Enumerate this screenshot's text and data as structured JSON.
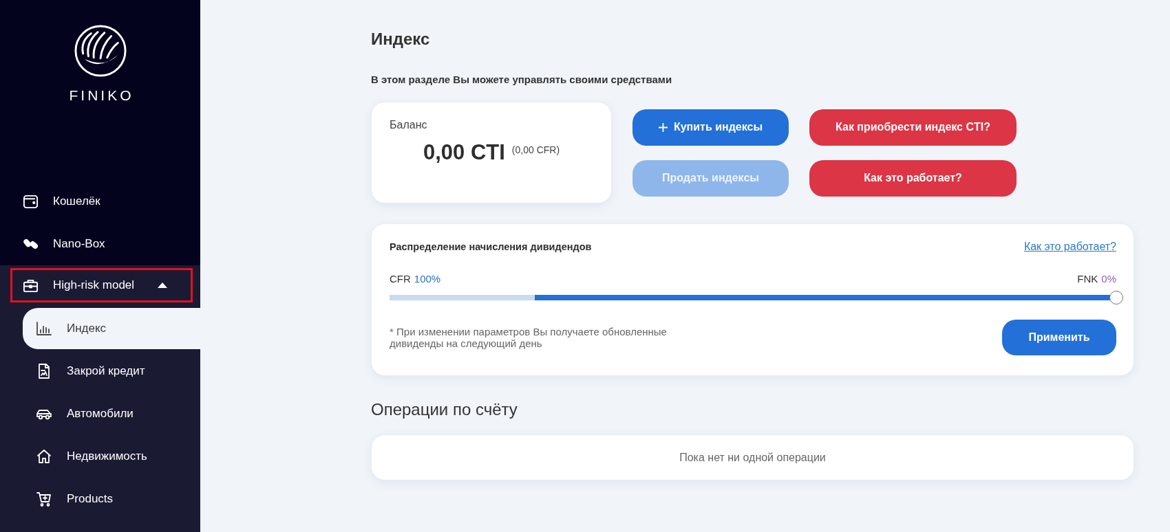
{
  "sidebar": {
    "logo_text": "FINIKO",
    "items": [
      {
        "label": "Кошелёк",
        "selected": false,
        "outlined": false
      },
      {
        "label": "Nano-Box",
        "selected": false,
        "outlined": false
      },
      {
        "label": "High-risk model",
        "selected": false,
        "outlined": true,
        "expanded": true,
        "children": [
          {
            "label": "Индекс",
            "selected": true
          },
          {
            "label": "Закрой кредит",
            "selected": false
          },
          {
            "label": "Автомобили",
            "selected": false
          },
          {
            "label": "Недвижимость",
            "selected": false
          },
          {
            "label": "Products",
            "selected": false
          }
        ]
      }
    ]
  },
  "page": {
    "title": "Индекс",
    "subtitle": "В этом разделе Вы можете управлять своими средствами"
  },
  "balance": {
    "label": "Баланс",
    "amount": "0,00 CTI",
    "secondary": "(0,00 CFR)"
  },
  "actions": [
    {
      "label": "Купить индексы",
      "kind": "add",
      "disabled": false
    },
    {
      "label": "Как приобрести индекс CTI?",
      "kind": "help",
      "disabled": false
    },
    {
      "label": "Продать индексы",
      "kind": "primary",
      "disabled": true
    },
    {
      "label": "Как это работает?",
      "kind": "help",
      "disabled": false
    }
  ],
  "dividends": {
    "title": "Распределение начисления дивидендов",
    "link": "Как это работает?",
    "left": {
      "name": "CFR",
      "percent": "100%"
    },
    "right": {
      "name": "FNK",
      "percent": "0%"
    },
    "slider": {
      "level": 1
    },
    "note": "* При изменении параметров Вы получаете обновленные дивиденды на следующий день",
    "apply": "Применить"
  },
  "operations": {
    "title": "Операции по счёту",
    "empty_text": "Пока нет ни одной операции"
  }
}
